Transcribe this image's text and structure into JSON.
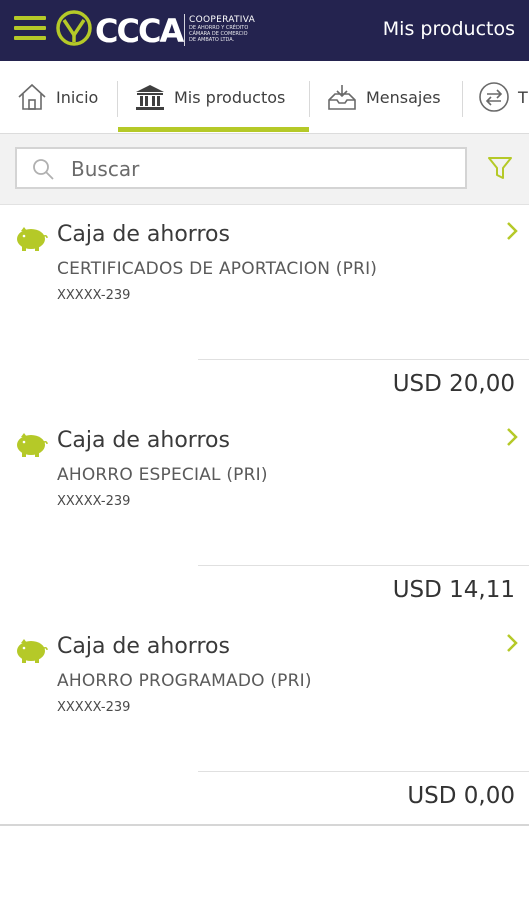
{
  "header": {
    "logo_letters": "CCCA",
    "logo_line1": "COOPERATIVA",
    "logo_line2": "DE AHORRO Y CRÉDITO",
    "logo_line3": "CÁMARA DE COMERCIO",
    "logo_line4": "DE AMBATO LTDA.",
    "title": "Mis productos"
  },
  "tabs": [
    {
      "label": "Inicio",
      "icon": "home-icon"
    },
    {
      "label": "Mis productos",
      "icon": "bank-icon",
      "active": true
    },
    {
      "label": "Mensajes",
      "icon": "inbox-icon"
    },
    {
      "label": "T",
      "icon": "transfer-icon"
    }
  ],
  "search": {
    "placeholder": "Buscar"
  },
  "products": [
    {
      "type": "Caja de ahorros",
      "name": "CERTIFICADOS DE APORTACION (PRI)",
      "account": "XXXXX-239",
      "amount": "USD 20,00"
    },
    {
      "type": "Caja de ahorros",
      "name": "AHORRO ESPECIAL (PRI)",
      "account": "XXXXX-239",
      "amount": "USD 14,11"
    },
    {
      "type": "Caja de ahorros",
      "name": "AHORRO PROGRAMADO (PRI)",
      "account": "XXXXX-239",
      "amount": "USD 0,00"
    }
  ],
  "colors": {
    "header_bg": "#24234f",
    "accent": "#b5c928"
  }
}
